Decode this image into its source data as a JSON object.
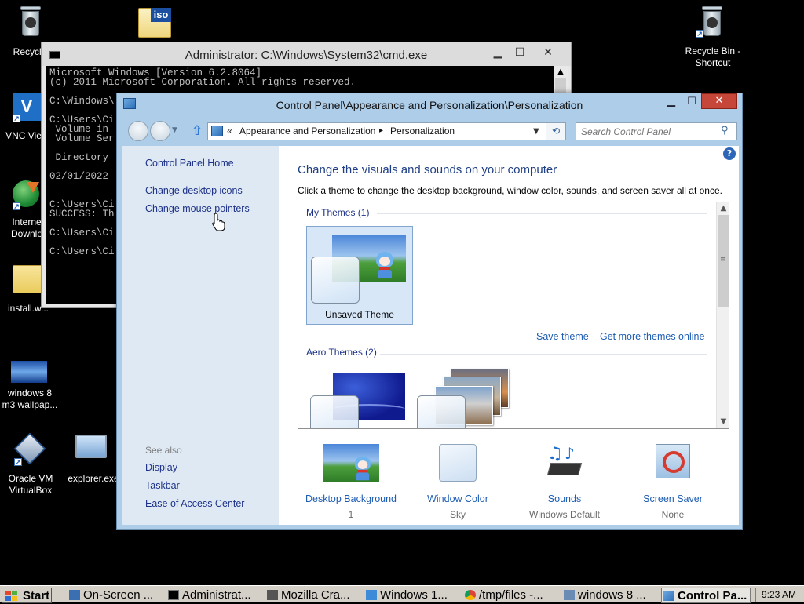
{
  "desktop": {
    "icons": {
      "recycle_left": "Recycle",
      "iso_label": "iso",
      "vnc": "VNC Vie",
      "internet": "Interne\nDownlo",
      "install": "install.w...",
      "wallpaper": "windows 8\nm3 wallpap...",
      "virtualbox": "Oracle VM\nVirtualBox",
      "explorer": "explorer.exe",
      "recycle_right": "Recycle Bin -\nShortcut"
    }
  },
  "cmd": {
    "title": "Administrator: C:\\Windows\\System32\\cmd.exe",
    "lines": [
      "Microsoft Windows [Version 6.2.8064]",
      "(c) 2011 Microsoft Corporation. All rights reserved.",
      "",
      "C:\\Windows\\",
      "",
      "C:\\Users\\Ci",
      " Volume in",
      " Volume Ser",
      "",
      " Directory",
      "",
      "02/01/2022",
      "",
      "",
      "C:\\Users\\Ci",
      "SUCCESS: Th",
      "",
      "C:\\Users\\Ci",
      "",
      "C:\\Users\\Ci"
    ]
  },
  "controlpanel": {
    "title": "Control Panel\\Appearance and Personalization\\Personalization",
    "address": {
      "chevrons": "«",
      "crumb1": "Appearance and Personalization",
      "sep": "▸",
      "crumb2": "Personalization"
    },
    "search_placeholder": "Search Control Panel",
    "left": {
      "home": "Control Panel Home",
      "desktop_icons": "Change desktop icons",
      "mouse_pointers": "Change mouse pointers",
      "see_also": "See also",
      "display": "Display",
      "taskbar": "Taskbar",
      "ease": "Ease of Access Center"
    },
    "heading": "Change the visuals and sounds on your computer",
    "subheading": "Click a theme to change the desktop background, window color, sounds, and screen saver all at once.",
    "my_themes": "My Themes (1)",
    "unsaved_theme": "Unsaved Theme",
    "save_theme": "Save theme",
    "get_more": "Get more themes online",
    "aero_themes": "Aero Themes (2)",
    "bottom": [
      {
        "label": "Desktop Background",
        "value": "1"
      },
      {
        "label": "Window Color",
        "value": "Sky"
      },
      {
        "label": "Sounds",
        "value": "Windows Default"
      },
      {
        "label": "Screen Saver",
        "value": "None"
      }
    ]
  },
  "taskbar": {
    "start": "Start",
    "items": [
      "On-Screen ...",
      "Administrat...",
      "Mozilla Cra...",
      "Windows 1...",
      "/tmp/files -...",
      "windows 8 ...",
      "Control Pa..."
    ],
    "clock": "9:23 AM"
  },
  "colors": {
    "link": "#1e3287",
    "accent_blue": "#1f3f84",
    "close_red": "#c7463a",
    "window_frame": "#aecde9"
  }
}
